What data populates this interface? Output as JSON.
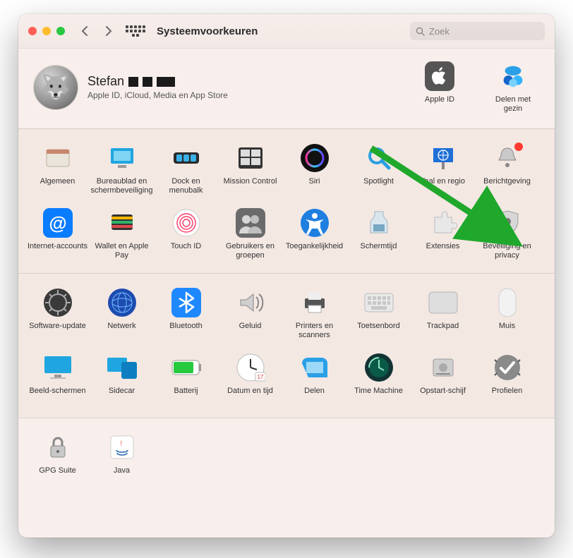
{
  "titlebar": {
    "title": "Systeemvoorkeuren",
    "search_placeholder": "Zoek"
  },
  "user": {
    "name": "Stefan",
    "subtitle": "Apple ID, iCloud, Media en App Store"
  },
  "header_actions": {
    "apple_id": "Apple ID",
    "family": "Delen met gezin"
  },
  "sections": [
    {
      "rows": [
        [
          {
            "key": "general",
            "label": "Algemeen"
          },
          {
            "key": "desktop",
            "label": "Bureaublad en schermbeveiliging"
          },
          {
            "key": "dock",
            "label": "Dock en menubalk"
          },
          {
            "key": "mission",
            "label": "Mission Control"
          },
          {
            "key": "siri",
            "label": "Siri"
          },
          {
            "key": "spotlight",
            "label": "Spotlight"
          },
          {
            "key": "language",
            "label": "Taal en regio"
          },
          {
            "key": "notifications",
            "label": "Berichtgeving"
          }
        ],
        [
          {
            "key": "internet",
            "label": "Internet-accounts"
          },
          {
            "key": "wallet",
            "label": "Wallet en Apple Pay"
          },
          {
            "key": "touchid",
            "label": "Touch ID"
          },
          {
            "key": "users",
            "label": "Gebruikers en groepen"
          },
          {
            "key": "accessibility",
            "label": "Toegankelijkheid"
          },
          {
            "key": "screentime",
            "label": "Schermtijd"
          },
          {
            "key": "extensions",
            "label": "Extensies"
          },
          {
            "key": "security",
            "label": "Beveiliging en privacy"
          }
        ]
      ]
    },
    {
      "rows": [
        [
          {
            "key": "swupdate",
            "label": "Software-update"
          },
          {
            "key": "network",
            "label": "Netwerk"
          },
          {
            "key": "bluetooth",
            "label": "Bluetooth"
          },
          {
            "key": "sound",
            "label": "Geluid"
          },
          {
            "key": "printers",
            "label": "Printers en scanners"
          },
          {
            "key": "keyboard",
            "label": "Toetsenbord"
          },
          {
            "key": "trackpad",
            "label": "Trackpad"
          },
          {
            "key": "mouse",
            "label": "Muis"
          }
        ],
        [
          {
            "key": "displays",
            "label": "Beeld-schermen"
          },
          {
            "key": "sidecar",
            "label": "Sidecar"
          },
          {
            "key": "battery",
            "label": "Batterij"
          },
          {
            "key": "datetime",
            "label": "Datum en tijd"
          },
          {
            "key": "sharing",
            "label": "Delen"
          },
          {
            "key": "timemachine",
            "label": "Time Machine"
          },
          {
            "key": "startup",
            "label": "Opstart-schijf"
          },
          {
            "key": "profiles",
            "label": "Profielen"
          }
        ]
      ]
    },
    {
      "rows": [
        [
          {
            "key": "gpg",
            "label": "GPG Suite"
          },
          {
            "key": "java",
            "label": "Java"
          }
        ]
      ]
    }
  ],
  "annotation": {
    "arrow_target": "security"
  }
}
